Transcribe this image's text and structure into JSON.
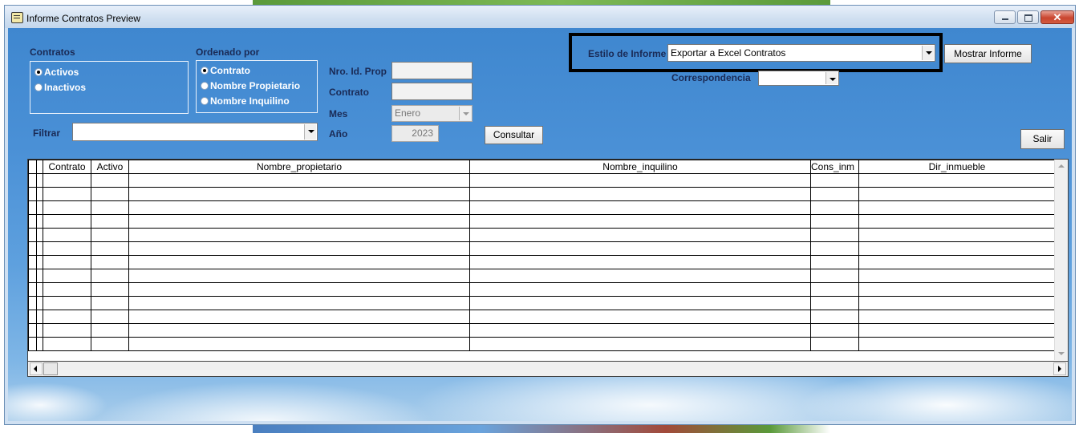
{
  "window": {
    "title": "Informe Contratos Preview",
    "close_glyph": "✕"
  },
  "contratos_group": {
    "label": "Contratos",
    "options": [
      {
        "label": "Activos",
        "selected": true
      },
      {
        "label": "Inactivos",
        "selected": false
      }
    ]
  },
  "ordenado_group": {
    "label": "Ordenado por",
    "options": [
      {
        "label": "Contrato",
        "selected": true
      },
      {
        "label": "Nombre Propietario",
        "selected": false
      },
      {
        "label": "Nombre Inquilino",
        "selected": false
      }
    ]
  },
  "filters": {
    "filtrar_label": "Filtrar",
    "filtrar_value": "",
    "nro_id_prop_label": "Nro. Id. Prop",
    "nro_id_prop_value": "",
    "contrato_label": "Contrato",
    "contrato_value": "",
    "mes_label": "Mes",
    "mes_value": "Enero",
    "anio_label": "Año",
    "anio_value": "2023"
  },
  "buttons": {
    "consultar": "Consultar",
    "mostrar_informe": "Mostrar Informe",
    "salir": "Salir"
  },
  "report": {
    "estilo_label": "Estilo de Informe",
    "estilo_value": "Exportar a Excel Contratos",
    "correspondencia_label": "Correspondencia",
    "correspondencia_value": ""
  },
  "grid": {
    "columns": [
      "",
      "",
      "Contrato",
      "Activo",
      "Nombre_propietario",
      "Nombre_inquilino",
      "Cons_inm",
      "Dir_inmueble"
    ],
    "empty_rows": 13
  },
  "colors": {
    "highlight_border": "#000000",
    "radio_text": "#ffffff"
  }
}
